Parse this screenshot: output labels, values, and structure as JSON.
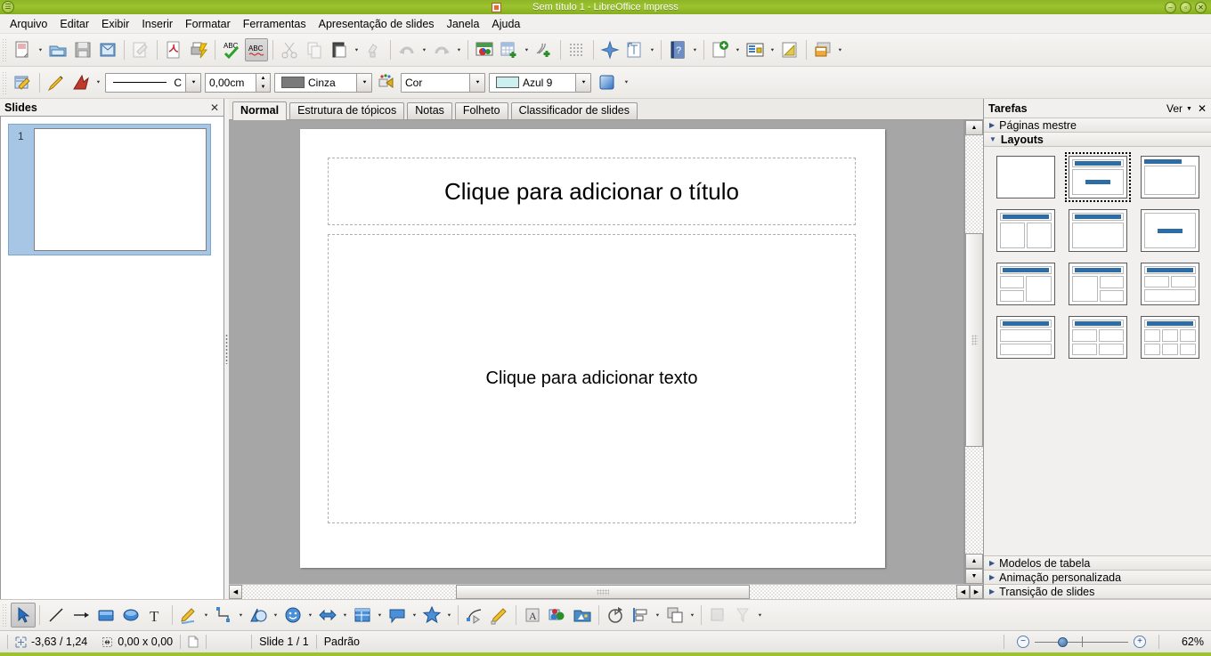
{
  "window": {
    "title": "Sem título 1 - LibreOffice Impress",
    "minimize": "–",
    "maximize": "▫",
    "close": "✕"
  },
  "menubar": {
    "items": [
      {
        "label": "Arquivo"
      },
      {
        "label": "Editar"
      },
      {
        "label": "Exibir"
      },
      {
        "label": "Inserir"
      },
      {
        "label": "Formatar"
      },
      {
        "label": "Ferramentas"
      },
      {
        "label": "Apresentação de slides"
      },
      {
        "label": "Janela"
      },
      {
        "label": "Ajuda"
      }
    ]
  },
  "toolbar_main": {
    "buttons": [
      {
        "name": "new-document",
        "title": "Novo"
      },
      {
        "name": "open-document",
        "title": "Abrir"
      },
      {
        "name": "save-document",
        "title": "Salvar"
      },
      {
        "name": "email-document",
        "title": "Enviar por e-mail"
      },
      {
        "name": "edit-file",
        "title": "Editar arquivo"
      },
      {
        "name": "export-pdf",
        "title": "Exportar como PDF"
      },
      {
        "name": "print-file",
        "title": "Imprimir arquivo diretamente"
      },
      {
        "name": "spelling",
        "title": "Ortografia e gramática"
      },
      {
        "name": "autospellcheck",
        "title": "Autoverificação ortográfica"
      },
      {
        "name": "cut",
        "title": "Cortar"
      },
      {
        "name": "copy",
        "title": "Copiar"
      },
      {
        "name": "paste",
        "title": "Colar"
      },
      {
        "name": "clone-formatting",
        "title": "Clonar formatação"
      },
      {
        "name": "undo",
        "title": "Desfazer"
      },
      {
        "name": "redo",
        "title": "Refazer"
      },
      {
        "name": "insert-chart",
        "title": "Inserir gráfico"
      },
      {
        "name": "insert-table",
        "title": "Tabela"
      },
      {
        "name": "insert-special-char",
        "title": "Caractere especial"
      },
      {
        "name": "display-grid",
        "title": "Exibir grade"
      },
      {
        "name": "show-draw-functions",
        "title": "Mostrar funções de desenho"
      },
      {
        "name": "insert-text-box",
        "title": "Caixa de texto"
      },
      {
        "name": "help",
        "title": "Ajuda do LibreOffice"
      },
      {
        "name": "new-slide",
        "title": "Novo slide"
      },
      {
        "name": "slide-layout",
        "title": "Layout de slide"
      },
      {
        "name": "start-slideshow",
        "title": "Apresentação de slides"
      },
      {
        "name": "master-slide",
        "title": "Slide mestre"
      }
    ]
  },
  "toolbar_line": {
    "line_style_label": "C",
    "line_width": "0,00cm",
    "line_color": "Cinza",
    "area_style": "Cor",
    "area_color": "Azul 9",
    "area_color_hex": "#ccf0ef",
    "buttons": [
      {
        "name": "line-and-filling",
        "title": "Linha e preenchimento"
      },
      {
        "name": "line-style-edit",
        "title": "Estilo de linha"
      },
      {
        "name": "arrow-style",
        "title": "Estilo de seta"
      },
      {
        "name": "area-style-dialog",
        "title": "Área"
      },
      {
        "name": "shadow",
        "title": "Sombra"
      }
    ]
  },
  "slides_panel": {
    "title": "Slides",
    "close": "✕",
    "slides": [
      {
        "number": "1"
      }
    ]
  },
  "view_tabs": {
    "items": [
      {
        "label": "Normal",
        "active": true
      },
      {
        "label": "Estrutura de tópicos",
        "active": false
      },
      {
        "label": "Notas",
        "active": false
      },
      {
        "label": "Folheto",
        "active": false
      },
      {
        "label": "Classificador de slides",
        "active": false
      }
    ]
  },
  "slide_canvas": {
    "title_placeholder": "Clique para adicionar o título",
    "body_placeholder": "Clique para adicionar texto"
  },
  "tasks_panel": {
    "title": "Tarefas",
    "view_label": "Ver",
    "close": "✕",
    "sections": [
      {
        "label": "Páginas mestre",
        "expanded": false
      },
      {
        "label": "Layouts",
        "expanded": true
      },
      {
        "label": "Modelos de tabela",
        "expanded": false
      },
      {
        "label": "Animação personalizada",
        "expanded": false
      },
      {
        "label": "Transição de slides",
        "expanded": false
      }
    ],
    "layouts": [
      {
        "name": "blank-slide",
        "kind": "blank",
        "selected": false
      },
      {
        "name": "title-content",
        "kind": "title-content",
        "selected": true
      },
      {
        "name": "title-only-box",
        "kind": "title-box",
        "selected": false
      },
      {
        "name": "title-two-content",
        "kind": "title-two",
        "selected": false
      },
      {
        "name": "title-content-two-right",
        "kind": "title-one-two",
        "selected": false
      },
      {
        "name": "centered-text",
        "kind": "centered",
        "selected": false
      },
      {
        "name": "title-two-left-one-right",
        "kind": "title-twoleft-oneright",
        "selected": false
      },
      {
        "name": "title-one-left-two-right",
        "kind": "title-oneleft-tworight",
        "selected": false
      },
      {
        "name": "title-two-top-one-bottom",
        "kind": "title-twotop-onebottom",
        "selected": false
      },
      {
        "name": "title-two-stacked",
        "kind": "title-stacked",
        "selected": false
      },
      {
        "name": "title-four-content",
        "kind": "title-four",
        "selected": false
      },
      {
        "name": "title-six-content",
        "kind": "title-six",
        "selected": false
      }
    ]
  },
  "drawing_toolbar": {
    "buttons": [
      {
        "name": "select-tool",
        "title": "Selecionar",
        "active": true
      },
      {
        "name": "line-tool",
        "title": "Linha"
      },
      {
        "name": "line-arrow-tool",
        "title": "Linha terminando em seta"
      },
      {
        "name": "rectangle-tool",
        "title": "Retângulo"
      },
      {
        "name": "ellipse-tool",
        "title": "Elipse"
      },
      {
        "name": "text-tool",
        "title": "Caixa de texto"
      },
      {
        "name": "curve-tool",
        "title": "Curva"
      },
      {
        "name": "connector-tool",
        "title": "Conector"
      },
      {
        "name": "basic-shapes-tool",
        "title": "Formas básicas"
      },
      {
        "name": "symbol-shapes-tool",
        "title": "Formas de símbolos"
      },
      {
        "name": "block-arrows-tool",
        "title": "Setas cheias"
      },
      {
        "name": "flowchart-tool",
        "title": "Fluxogramas"
      },
      {
        "name": "callout-tool",
        "title": "Textos explicativos"
      },
      {
        "name": "stars-tool",
        "title": "Estrelas"
      },
      {
        "name": "points-tool",
        "title": "Editar pontos"
      },
      {
        "name": "glue-points-tool",
        "title": "Pontos de colagem"
      },
      {
        "name": "fontwork-tool",
        "title": "Galeria de Fontwork"
      },
      {
        "name": "insert-image-tool",
        "title": "Figura"
      },
      {
        "name": "gallery-tool",
        "title": "Galeria"
      },
      {
        "name": "rotate-tool",
        "title": "Girar"
      },
      {
        "name": "alignment-tool",
        "title": "Alinhamento"
      },
      {
        "name": "arrange-tool",
        "title": "Dispor"
      },
      {
        "name": "shadow-tool",
        "title": "Sombra"
      },
      {
        "name": "filter-tool",
        "title": "Filtro"
      }
    ]
  },
  "statusbar": {
    "cursor_position": "-3,63 / 1,24",
    "object_size": "0,00 x 0,00",
    "slide_info": "Slide 1 / 1",
    "master_name": "Padrão",
    "zoom_out": "−",
    "zoom_in": "+",
    "zoom_level": "62%"
  }
}
